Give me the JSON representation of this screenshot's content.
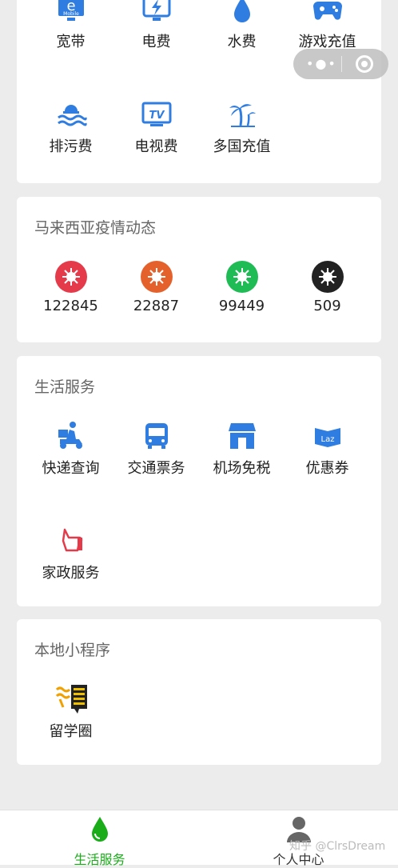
{
  "colors": {
    "blue": "#2f7de1",
    "green": "#1aad19"
  },
  "bill_section": {
    "items": [
      {
        "label": "宽带",
        "icon": "broadband-icon"
      },
      {
        "label": "电费",
        "icon": "electricity-icon"
      },
      {
        "label": "水费",
        "icon": "water-icon"
      },
      {
        "label": "游戏充值",
        "icon": "gamepad-icon"
      },
      {
        "label": "排污费",
        "icon": "sewage-icon"
      },
      {
        "label": "电视费",
        "icon": "tv-icon"
      },
      {
        "label": "多国充值",
        "icon": "palm-tree-icon"
      }
    ]
  },
  "broadband_icon_text": "e",
  "broadband_icon_subtext": "Mobile",
  "tv_icon_text": "TV",
  "covid": {
    "title": "马来西亚疫情动态",
    "stats": [
      {
        "value": "122845",
        "color": "#e53a4a"
      },
      {
        "value": "22887",
        "color": "#e4612c"
      },
      {
        "value": "99449",
        "color": "#1fbb54"
      },
      {
        "value": "509",
        "color": "#222222"
      }
    ]
  },
  "life": {
    "title": "生活服务",
    "items": [
      {
        "label": "快递查询",
        "icon": "delivery-icon"
      },
      {
        "label": "交通票务",
        "icon": "bus-icon"
      },
      {
        "label": "机场免税",
        "icon": "store-icon"
      },
      {
        "label": "优惠券",
        "icon": "coupon-icon"
      },
      {
        "label": "家政服务",
        "icon": "hand-icon"
      }
    ]
  },
  "coupon_icon_text": "Laz",
  "local": {
    "title": "本地小程序",
    "items": [
      {
        "label": "留学圈",
        "icon": "study-circle-logo"
      }
    ]
  },
  "tabbar": {
    "tabs": [
      {
        "label": "生活服务",
        "active": true
      },
      {
        "label": "个人中心",
        "active": false
      }
    ]
  },
  "watermark": "知乎 @ClrsDream"
}
